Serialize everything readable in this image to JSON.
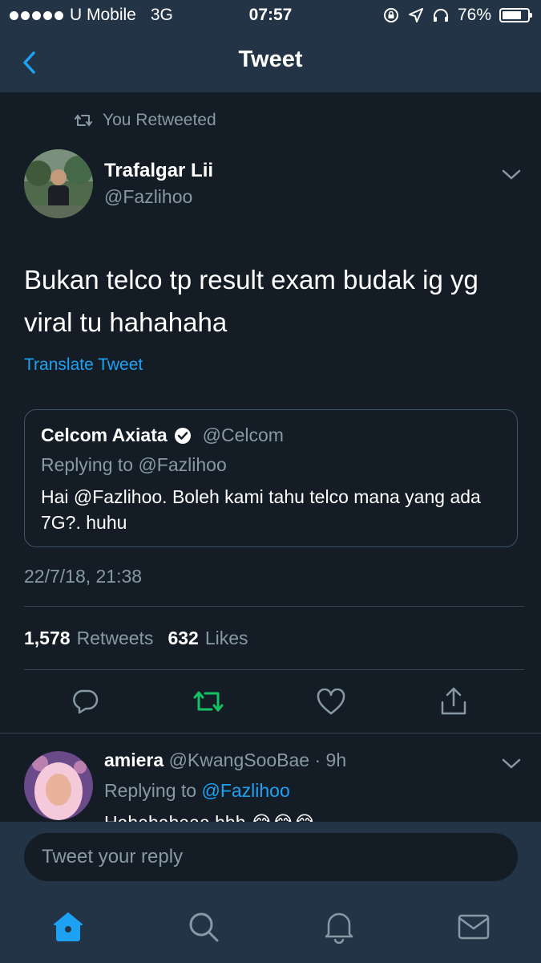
{
  "status_bar": {
    "carrier": "U Mobile",
    "network": "3G",
    "time": "07:57",
    "battery": "76%",
    "battery_level": 0.76
  },
  "nav": {
    "title": "Tweet"
  },
  "tweet": {
    "retweet_context": "You Retweeted",
    "author_name": "Trafalgar Lii",
    "author_handle": "@Fazlihoo",
    "text": "Bukan telco tp result exam budak ig yg viral tu hahahaha",
    "translate": "Translate Tweet",
    "timestamp": "22/7/18, 21:38",
    "retweets_count": "1,578",
    "retweets_label": "Retweets",
    "likes_count": "632",
    "likes_label": "Likes"
  },
  "quoted": {
    "name": "Celcom Axiata",
    "handle": "@Celcom",
    "replying": "Replying to @Fazlihoo",
    "text": "Hai @Fazlihoo. Boleh kami tahu telco mana yang ada 7G?. huhu"
  },
  "reply": {
    "name": "amiera",
    "handle": "@KwangSooBae",
    "age": "· 9h",
    "replying_prefix": "Replying to",
    "replying_handle": "@Fazlihoo",
    "text": "Hahahahaaa.hhh 😂😂😂"
  },
  "composer": {
    "placeholder": "Tweet your reply"
  },
  "colors": {
    "background": "#141d26",
    "bar": "#243447",
    "accent": "#1da1f2",
    "retweet_active": "#17bf63",
    "muted": "#8899a6"
  },
  "icons": {
    "back": "chevron-left-icon",
    "retweet_context": "retweet-icon",
    "menu": "chevron-down-icon",
    "verified": "verified-badge-icon",
    "reply": "reply-icon",
    "retweet": "retweet-icon",
    "like": "heart-icon",
    "share": "share-icon",
    "home": "home-icon",
    "search": "search-icon",
    "notifications": "bell-icon",
    "messages": "mail-icon"
  }
}
